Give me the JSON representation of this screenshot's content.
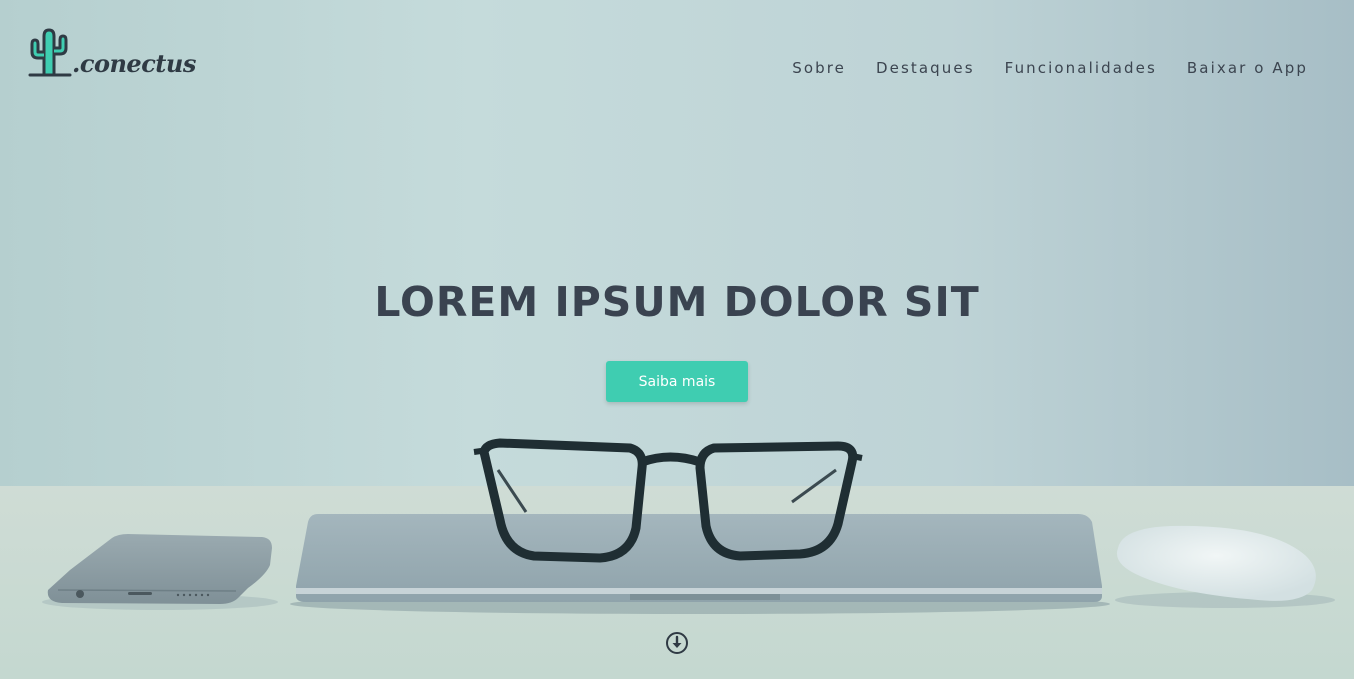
{
  "brand": {
    "name": ".conectus",
    "logo_icon": "cactus-icon",
    "accent_color": "#3fcdb1"
  },
  "nav": {
    "items": [
      {
        "label": "Sobre"
      },
      {
        "label": "Destaques"
      },
      {
        "label": "Funcionalidades"
      },
      {
        "label": "Baixar o App"
      }
    ]
  },
  "hero": {
    "title": "LOREM IPSUM DOLOR SIT",
    "cta_label": "Saiba mais",
    "scroll_icon": "arrow-down-circle-icon"
  }
}
